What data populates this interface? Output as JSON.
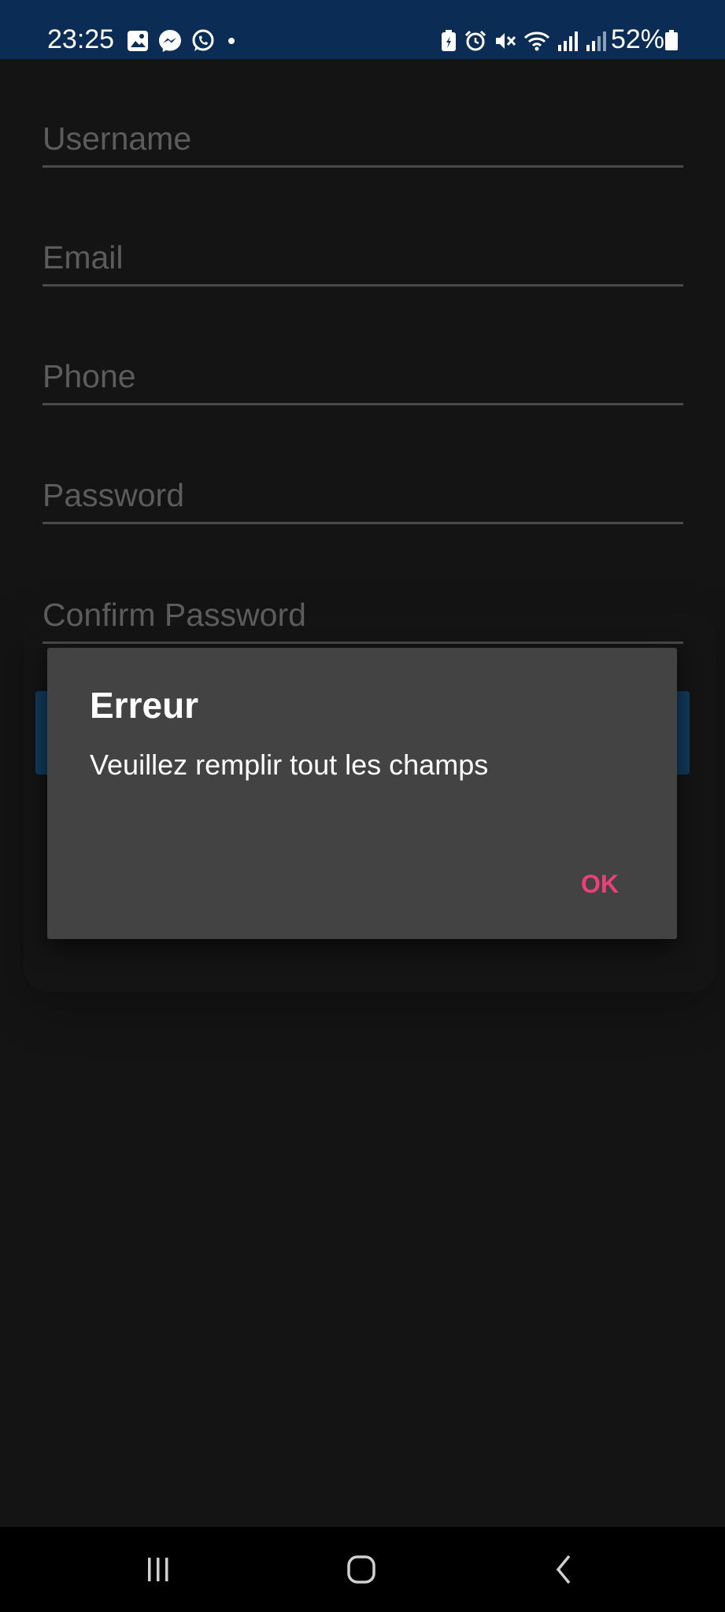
{
  "status_bar": {
    "time": "23:25",
    "battery_percent": "52%",
    "left_icons": [
      "gallery-icon",
      "messenger-icon",
      "whatsapp-icon",
      "notification-dot-icon"
    ],
    "right_icons": [
      "battery-saver-icon",
      "alarm-icon",
      "mute-icon",
      "wifi-icon",
      "signal-icon",
      "signal-icon"
    ]
  },
  "form": {
    "fields": [
      {
        "label": "Username"
      },
      {
        "label": "Email"
      },
      {
        "label": "Phone"
      },
      {
        "label": "Password"
      },
      {
        "label": "Confirm Password"
      }
    ]
  },
  "dialog": {
    "title": "Erreur",
    "message": "Veuillez remplir tout les champs",
    "ok_label": "OK"
  },
  "nav_bar": {
    "buttons": [
      "recent-apps-icon",
      "home-icon",
      "back-icon"
    ]
  },
  "colors": {
    "status_bar": "#0b2d55",
    "background": "#141414",
    "dialog": "#434343",
    "accent": "#ec407a"
  }
}
